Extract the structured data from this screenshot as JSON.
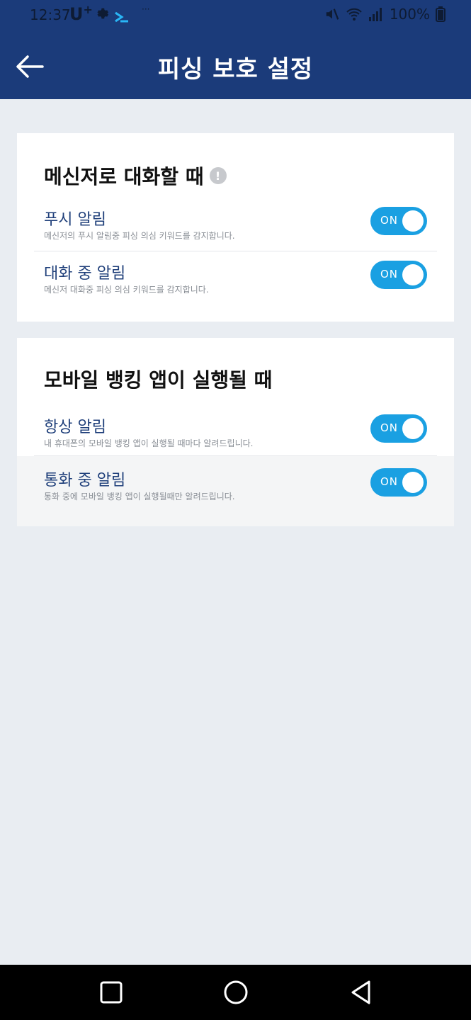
{
  "status_bar": {
    "time": "12:37",
    "carrier": "U",
    "carrier_sup": "+",
    "battery": "100%"
  },
  "app_bar": {
    "title": "피싱 보호 설정"
  },
  "sections": [
    {
      "title": "메신저로 대화할 때",
      "info_icon": "!",
      "items": [
        {
          "label": "푸시 알림",
          "desc": "메신저의 푸시 알림중 피싱 의심 키워드를 감지합니다.",
          "toggle": "ON"
        },
        {
          "label": "대화 중 알림",
          "desc": "메신저 대화중 피싱 의심 키워드를 감지합니다.",
          "toggle": "ON"
        }
      ]
    },
    {
      "title": "모바일 뱅킹 앱이 실행될 때",
      "items": [
        {
          "label": "항상 알림",
          "desc": "내 휴대폰의 모바일 뱅킹 앱이 실행될 때마다 알려드립니다.",
          "toggle": "ON"
        },
        {
          "label": "통화 중 알림",
          "desc": "통화 중에 모바일 뱅킹 앱이 실행될때만 알려드립니다.",
          "toggle": "ON"
        }
      ]
    }
  ],
  "colors": {
    "header": "#1b3b7a",
    "toggle_on": "#1aa0e2",
    "label": "#1f3f7a",
    "background": "#e9edf2"
  },
  "icons": {
    "back": "arrow-left-icon",
    "info": "info-icon",
    "nav_recents": "square-icon",
    "nav_home": "circle-icon",
    "nav_back": "triangle-back-icon"
  }
}
